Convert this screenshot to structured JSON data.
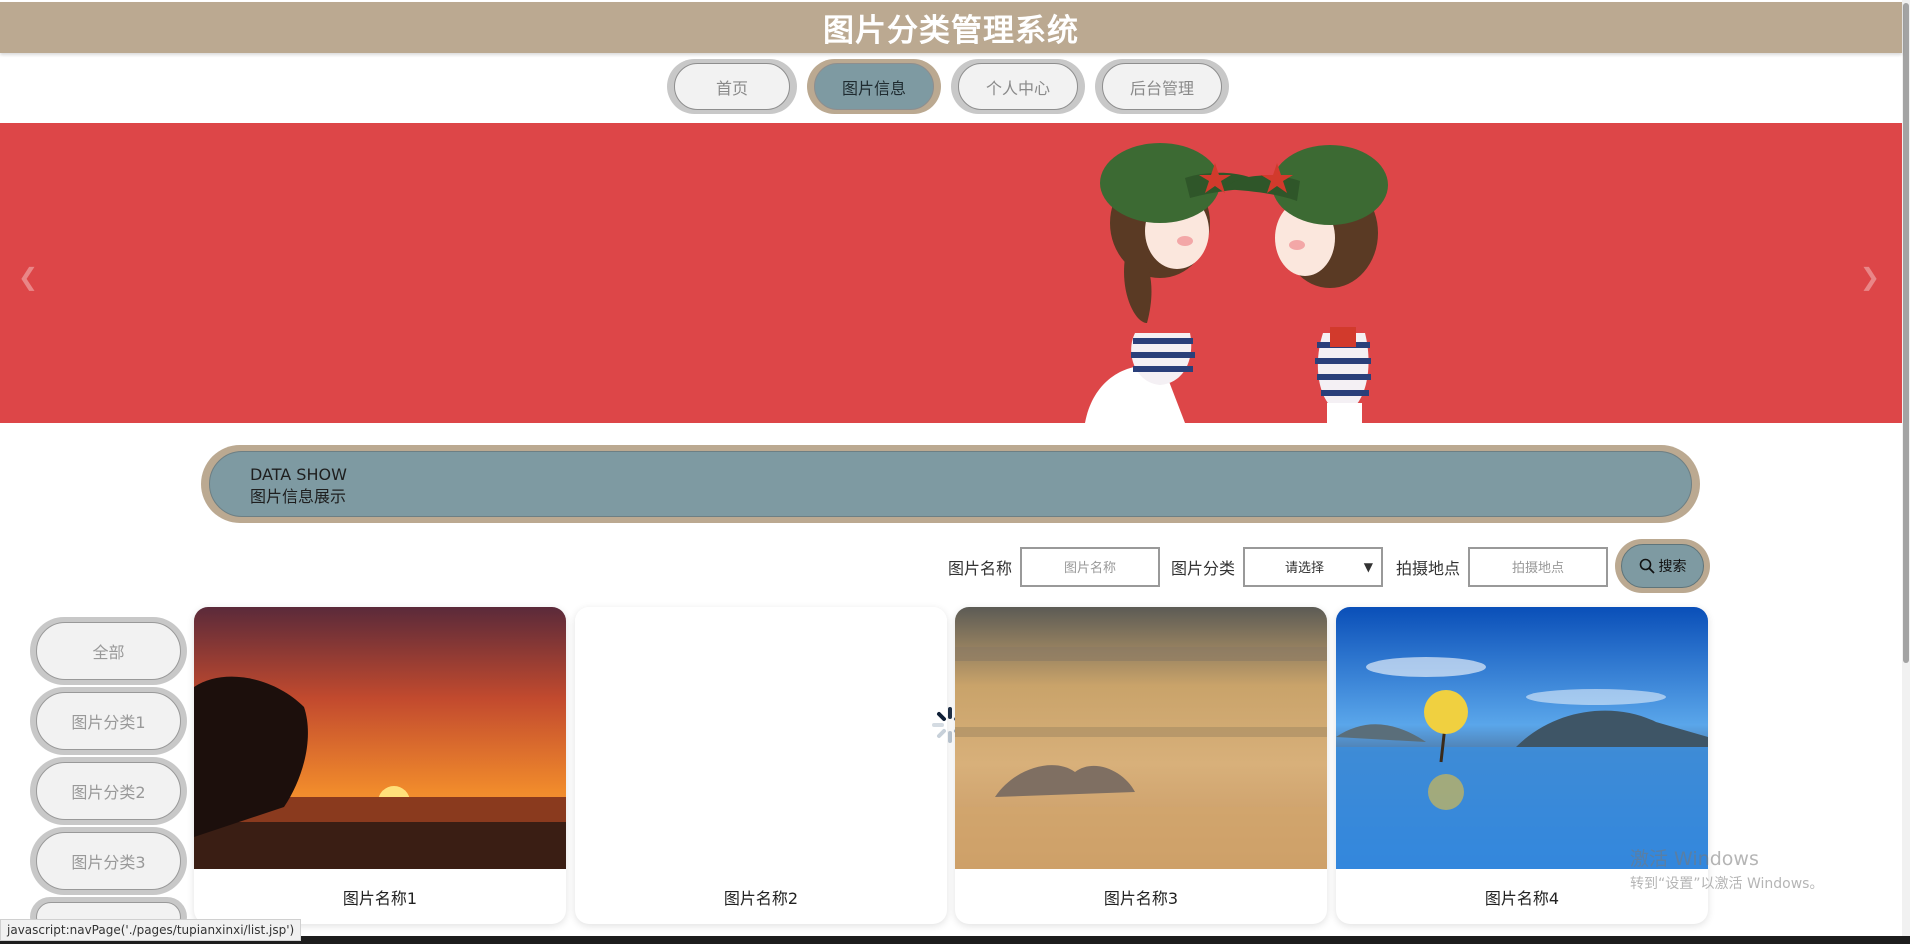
{
  "header": {
    "title": "图片分类管理系统"
  },
  "nav": [
    {
      "label": "首页",
      "active": false
    },
    {
      "label": "图片信息",
      "active": true
    },
    {
      "label": "个人中心",
      "active": false
    },
    {
      "label": "后台管理",
      "active": false
    }
  ],
  "banner": {
    "prev_icon": "chevron-left-icon",
    "next_icon": "chevron-right-icon",
    "background": "#dd4648"
  },
  "section": {
    "title_en": "DATA SHOW",
    "title_cn": "图片信息展示"
  },
  "search": {
    "name_label": "图片名称",
    "name_placeholder": "图片名称",
    "category_label": "图片分类",
    "category_selected": "请选择",
    "location_label": "拍摄地点",
    "location_placeholder": "拍摄地点",
    "button_label": "搜索",
    "button_icon": "search-icon"
  },
  "categories": [
    "全部",
    "图片分类1",
    "图片分类2",
    "图片分类3"
  ],
  "cards": [
    {
      "name": "图片名称1"
    },
    {
      "name": "图片名称2"
    },
    {
      "name": "图片名称3"
    },
    {
      "name": "图片名称4"
    }
  ],
  "statusbar": {
    "text": "javascript:navPage('./pages/tupianxinxi/list.jsp')"
  },
  "watermark": {
    "line1": "激活 Windows",
    "line2": "转到“设置”以激活 Windows。"
  },
  "colors": {
    "accent": "#bba991",
    "active": "#7e9aa2",
    "banner": "#dd4648"
  }
}
